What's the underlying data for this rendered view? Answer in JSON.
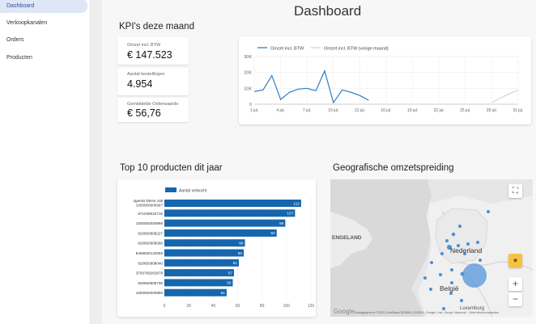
{
  "sidebar": {
    "items": [
      {
        "label": "Dashboard",
        "active": true
      },
      {
        "label": "Verkoopkanalen",
        "active": false
      },
      {
        "label": "Orders",
        "active": false
      },
      {
        "label": "Producten",
        "active": false
      }
    ]
  },
  "page": {
    "title": "Dashboard"
  },
  "kpi": {
    "title": "KPI's deze maand",
    "cards": [
      {
        "label": "Omzet incl. BTW",
        "value": "€ 147.523"
      },
      {
        "label": "Aantal bestellingen",
        "value": "4.954"
      },
      {
        "label": "Gemiddelde Orderwaarde",
        "value": "€ 56,76"
      }
    ]
  },
  "colors": {
    "accent": "#2e7fc6",
    "bar": "#1666ae",
    "prev_line": "#d4d4d4",
    "map_dot": "#4a8fd8",
    "sidebar_active_bg": "#dfe6f5"
  },
  "line_chart": {
    "type": "line",
    "legend": [
      "Omzet incl. BTW",
      "Omzet incl. BTW (vorige maand)"
    ],
    "x_labels": [
      "1 jul.",
      "4 jul.",
      "7 jul.",
      "10 jul.",
      "13 jul.",
      "16 jul.",
      "19 jul.",
      "22 jul.",
      "25 jul.",
      "28 jul.",
      "31 jul."
    ],
    "y_labels": [
      "30K",
      "20K",
      "10K",
      "0"
    ],
    "ylim": [
      0,
      30000
    ],
    "series": [
      {
        "name": "Omzet incl. BTW",
        "x": [
          1,
          2,
          3,
          4,
          5,
          6,
          7,
          8,
          9,
          10,
          11,
          12,
          13,
          14
        ],
        "values": [
          8000,
          9000,
          18000,
          3000,
          7500,
          9500,
          10000,
          8500,
          21000,
          1000,
          9000,
          7500,
          5500,
          2500
        ]
      },
      {
        "name": "Omzet incl. BTW (vorige maand)",
        "x": [
          28,
          29,
          30,
          31
        ],
        "values": [
          1000,
          4000,
          6500,
          9000
        ]
      }
    ]
  },
  "top10": {
    "title": "Top 10 producten dit jaar",
    "chart_data": {
      "type": "bar",
      "legend": "Aantal verkocht",
      "categories": [
        "4geeks kleine zak 1000000000997",
        "871039034715",
        "1000000000998",
        "820650808227",
        "820650808568",
        "8498830133055",
        "820650808040",
        "3700789263878",
        "820650808739",
        "1000000000990"
      ],
      "values": [
        112,
        107,
        99,
        92,
        66,
        65,
        61,
        57,
        56,
        51
      ],
      "xlim": [
        0,
        120
      ],
      "x_ticks": [
        "0",
        "20",
        "40",
        "60",
        "80",
        "100",
        "120"
      ]
    }
  },
  "geo": {
    "title": "Geografische omzetspreiding",
    "labels": {
      "country1": "ENGELAND",
      "country2": "Nederland",
      "country3": "België",
      "country4": "Luxemburg"
    },
    "footer": "Kaartgegevens ©2021 GeoBasis-DE/BKG (©2009), Google, Inst. Geogr. Nacional · Gebruiksvoorwaarden",
    "google": "Google",
    "zoom_in": "+",
    "zoom_out": "−",
    "fullscreen": "⛶"
  }
}
